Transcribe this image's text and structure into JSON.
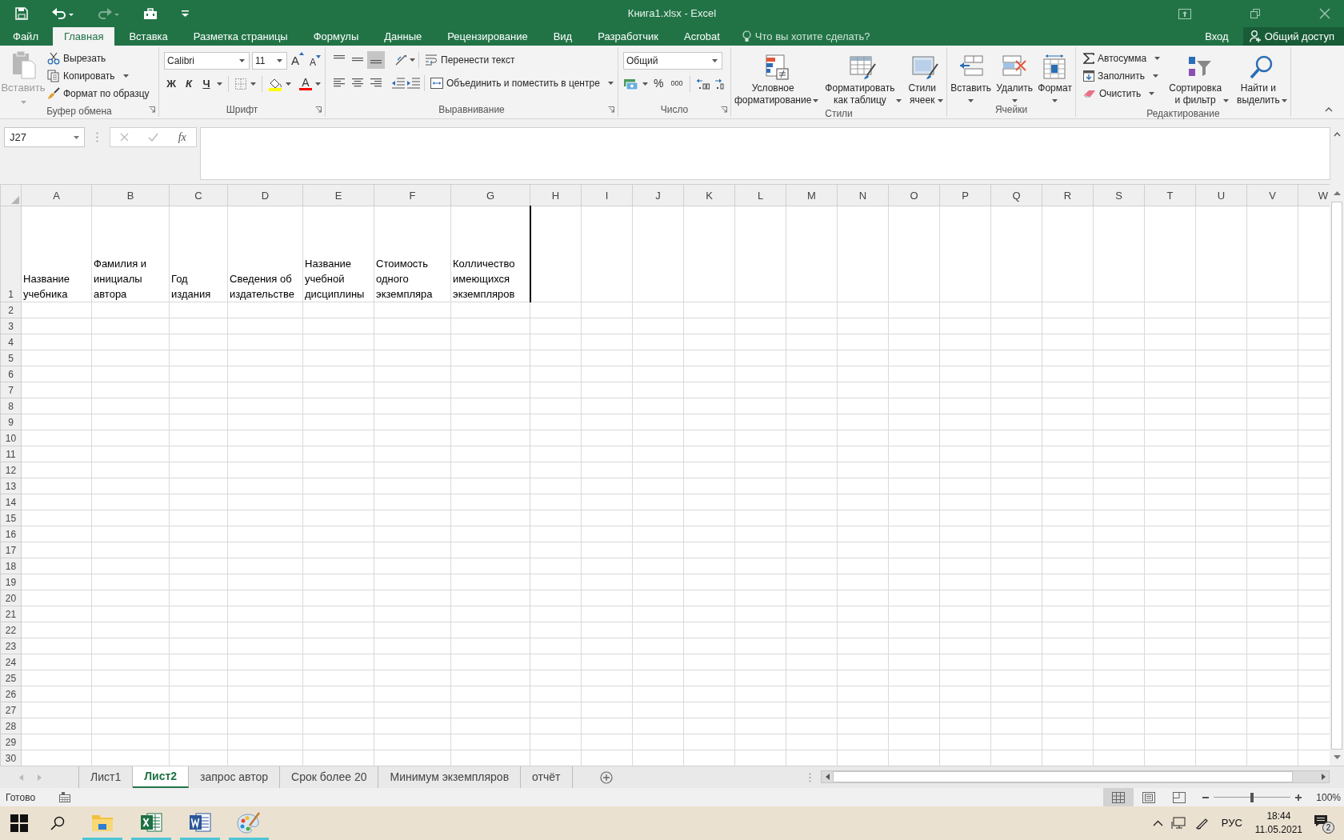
{
  "window": {
    "title": "Книга1.xlsx - Excel"
  },
  "quick_access": [
    {
      "kind": "save",
      "disabled": false
    },
    {
      "kind": "undo",
      "disabled": false
    },
    {
      "kind": "redo",
      "disabled": true
    },
    {
      "kind": "form",
      "disabled": false
    },
    {
      "kind": "customize",
      "disabled": false
    }
  ],
  "ribbon_tabs": [
    {
      "label": "Файл",
      "selected": false
    },
    {
      "label": "Главная",
      "selected": true
    },
    {
      "label": "Вставка",
      "selected": false
    },
    {
      "label": "Разметка страницы",
      "selected": false
    },
    {
      "label": "Формулы",
      "selected": false
    },
    {
      "label": "Данные",
      "selected": false
    },
    {
      "label": "Рецензирование",
      "selected": false
    },
    {
      "label": "Вид",
      "selected": false
    },
    {
      "label": "Разработчик",
      "selected": false
    },
    {
      "label": "Acrobat",
      "selected": false
    }
  ],
  "tell_me": {
    "placeholder": "Что вы хотите сделать?"
  },
  "account": {
    "sign_in": "Вход",
    "share": "Общий доступ"
  },
  "ribbon": {
    "groups": [
      {
        "kind": "clipboard",
        "label": "Буфер обмена",
        "launcher": true,
        "paste": {
          "label": "Вставить",
          "disabled": true
        },
        "commands": [
          {
            "label": "Вырезать",
            "dropdown": false
          },
          {
            "label": "Копировать",
            "dropdown": true
          },
          {
            "label": "Формат по образцу",
            "dropdown": false
          }
        ]
      },
      {
        "kind": "font",
        "label": "Шрифт",
        "launcher": true,
        "font_name": "Calibri",
        "font_size": "11",
        "grow": "A",
        "shrink": "A",
        "bold": "Ж",
        "italic": "К",
        "underline": "Ч",
        "font_color": "A"
      },
      {
        "kind": "alignment",
        "label": "Выравнивание",
        "launcher": true,
        "vertical_align": [
          {
            "selected": false
          },
          {
            "selected": false
          },
          {
            "selected": true
          }
        ],
        "horizontal_align": [
          {
            "selected": false
          },
          {
            "selected": false
          },
          {
            "selected": false
          }
        ],
        "wrap_text": "Перенести текст",
        "merge": "Объединить и поместить в центре"
      },
      {
        "kind": "number",
        "label": "Число",
        "launcher": true,
        "format": "Общий",
        "percent": "%",
        "thousands": "000"
      },
      {
        "kind": "styles",
        "label": "Стили",
        "launcher": false,
        "commands": [
          {
            "label": "Условное\nформатирование"
          },
          {
            "label": "Форматировать\nкак таблицу"
          },
          {
            "label": "Стили\nячеек"
          }
        ]
      },
      {
        "kind": "cells",
        "label": "Ячейки",
        "launcher": false,
        "commands": [
          {
            "label": "Вставить"
          },
          {
            "label": "Удалить"
          },
          {
            "label": "Формат"
          }
        ]
      },
      {
        "kind": "editing",
        "label": "Редактирование",
        "launcher": false,
        "commands": [
          {
            "label": "Автосумма"
          },
          {
            "label": "Заполнить"
          },
          {
            "label": "Очистить"
          }
        ],
        "large_commands": [
          {
            "label": "Сортировка\nи фильтр"
          },
          {
            "label": "Найти и\nвыделить"
          }
        ]
      }
    ]
  },
  "formula_bar": {
    "name_box": "J27",
    "function_button": "fx"
  },
  "sheet": {
    "columns": [
      "A",
      "B",
      "C",
      "D",
      "E",
      "F",
      "G",
      "H",
      "I",
      "J",
      "K",
      "L",
      "M",
      "N",
      "O",
      "P",
      "Q",
      "R",
      "S",
      "T",
      "U",
      "V",
      "W"
    ],
    "rows": [
      {
        "number": "1",
        "cells": [
          "Название учебника",
          "Фамилия и инициалы автора",
          "Год издания",
          "Сведения об издательстве",
          "Название учебной дисциплины",
          "Стоимость одного экземпляра",
          "Колличество имеющихся экземпляров"
        ]
      },
      {
        "number": "2"
      },
      {
        "number": "3"
      },
      {
        "number": "4"
      },
      {
        "number": "5"
      },
      {
        "number": "6"
      },
      {
        "number": "7"
      },
      {
        "number": "8"
      },
      {
        "number": "9"
      },
      {
        "number": "10"
      },
      {
        "number": "11"
      },
      {
        "number": "12"
      },
      {
        "number": "13"
      },
      {
        "number": "14"
      },
      {
        "number": "15"
      },
      {
        "number": "16"
      },
      {
        "number": "17"
      },
      {
        "number": "18"
      },
      {
        "number": "19"
      },
      {
        "number": "20"
      },
      {
        "number": "21"
      },
      {
        "number": "22"
      },
      {
        "number": "23"
      },
      {
        "number": "24"
      },
      {
        "number": "25"
      },
      {
        "number": "26"
      },
      {
        "number": "27"
      },
      {
        "number": "28"
      },
      {
        "number": "29"
      },
      {
        "number": "30"
      }
    ]
  },
  "sheet_tabs": [
    {
      "label": "Лист1",
      "selected": false
    },
    {
      "label": "Лист2",
      "selected": true
    },
    {
      "label": "запрос автор",
      "selected": false
    },
    {
      "label": "Срок более 20",
      "selected": false
    },
    {
      "label": "Минимум экземпляров",
      "selected": false
    },
    {
      "label": "отчёт",
      "selected": false
    }
  ],
  "status_bar": {
    "status": "Готово",
    "views": [
      {
        "selected": true
      },
      {
        "selected": false
      },
      {
        "selected": false
      }
    ],
    "zoom": {
      "level": 0.5,
      "reading": "100%"
    }
  },
  "taskbar": {
    "apps": [
      {
        "kind": "explorer",
        "running": true
      },
      {
        "kind": "excel",
        "running": true
      },
      {
        "kind": "word",
        "running": true
      },
      {
        "kind": "paint",
        "running": true
      }
    ],
    "language": "РУС",
    "time": "18:44",
    "date": "11.05.2021",
    "notifications": "2"
  }
}
